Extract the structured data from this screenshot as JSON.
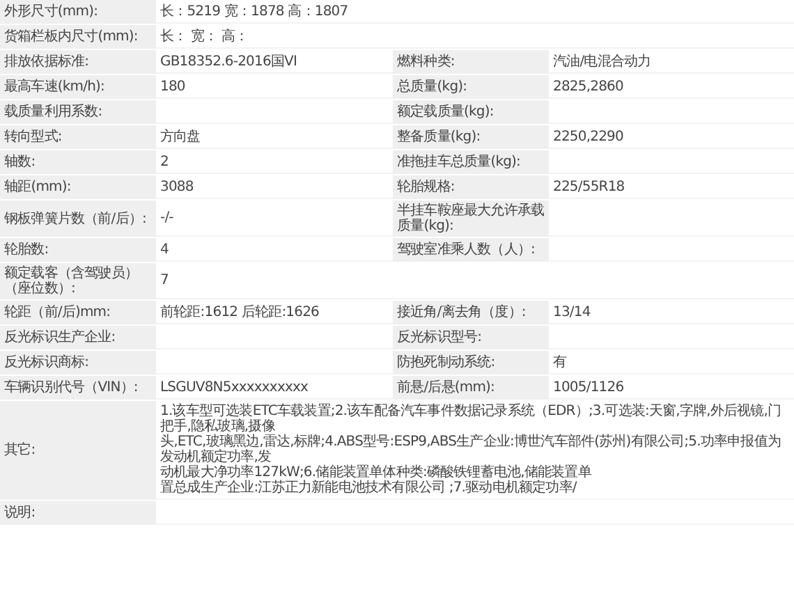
{
  "rows": [
    {
      "kind": "full",
      "fields": [
        {
          "label": "外形尺寸(mm):",
          "value": "长：5219 宽：1878 高：1807"
        }
      ]
    },
    {
      "kind": "full",
      "fields": [
        {
          "label": "货箱栏板内尺寸(mm):",
          "value": "长：  宽：  高："
        }
      ]
    },
    {
      "kind": "pair",
      "fields": [
        {
          "label": "排放依据标准:",
          "value": "GB18352.6-2016国VI"
        },
        {
          "label": "燃料种类:",
          "value": "汽油/电混合动力"
        }
      ]
    },
    {
      "kind": "pair",
      "fields": [
        {
          "label": "最高车速(km/h):",
          "value": "180"
        },
        {
          "label": "总质量(kg):",
          "value": "2825,2860"
        }
      ]
    },
    {
      "kind": "pair",
      "fields": [
        {
          "label": "载质量利用系数:"
        },
        {
          "label": "额定载质量(kg):"
        }
      ]
    },
    {
      "kind": "pair",
      "fields": [
        {
          "label": "转向型式:",
          "value": "方向盘"
        },
        {
          "label": "整备质量(kg):",
          "value": "2250,2290"
        }
      ]
    },
    {
      "kind": "pair",
      "fields": [
        {
          "label": "轴数:",
          "value": "2"
        },
        {
          "label": "准拖挂车总质量(kg):"
        }
      ]
    },
    {
      "kind": "pair",
      "fields": [
        {
          "label": "轴距(mm):",
          "value": "3088"
        },
        {
          "label": "轮胎规格:",
          "value": "225/55R18"
        }
      ]
    },
    {
      "kind": "pair",
      "fields": [
        {
          "label": "钢板弹簧片数（前/后）:",
          "value": "-/-"
        },
        {
          "label": "半挂车鞍座最大允许承载质量(kg):"
        }
      ]
    },
    {
      "kind": "pair",
      "fields": [
        {
          "label": "轮胎数:",
          "value": "4"
        },
        {
          "label": "驾驶室准乘人数（人）:"
        }
      ]
    },
    {
      "kind": "full",
      "fields": [
        {
          "label": "额定载客（含驾驶员）（座位数）:",
          "value": "7"
        }
      ]
    },
    {
      "kind": "pair",
      "fields": [
        {
          "label": "轮距（前/后)mm:",
          "value": "前轮距:1612 后轮距:1626"
        },
        {
          "label": "接近角/离去角（度）:",
          "value": "13/14"
        }
      ]
    },
    {
      "kind": "pair",
      "fields": [
        {
          "label": "反光标识生产企业:"
        },
        {
          "label": "反光标识型号:"
        }
      ]
    },
    {
      "kind": "pair",
      "fields": [
        {
          "label": "反光标识商标:"
        },
        {
          "label": "防抱死制动系统:",
          "value": "有"
        }
      ]
    },
    {
      "kind": "pair",
      "fields": [
        {
          "label": "车辆识别代号（VIN）:",
          "value": "LSGUV8N5xxxxxxxxxx"
        },
        {
          "label": "前悬/后悬(mm):",
          "value": "1005/1126"
        }
      ]
    },
    {
      "kind": "full",
      "fields": [
        {
          "label": "其它:",
          "lines": [
            "1.该车型可选装ETC车载装置;2.该车配备汽车事件数据记录系统（EDR）;3.可选装:天窗,字牌,外后视镜,门把手,隐私玻璃,摄像",
            "头,ETC,玻璃黑边,雷达,标牌;4.ABS型号:ESP9,ABS生产企业:博世汽车部件(苏州)有限公司;5.功率申报值为发动机额定功率,发",
            "动机最大净功率127kW;6.储能装置单体种类:磷酸铁锂蓄电池,储能装置单",
            "置总成生产企业:江苏正力新能电池技术有限公司 ;7.驱动电机额定功率/"
          ]
        }
      ]
    },
    {
      "kind": "full",
      "fields": [
        {
          "label": "说明:"
        }
      ]
    }
  ]
}
